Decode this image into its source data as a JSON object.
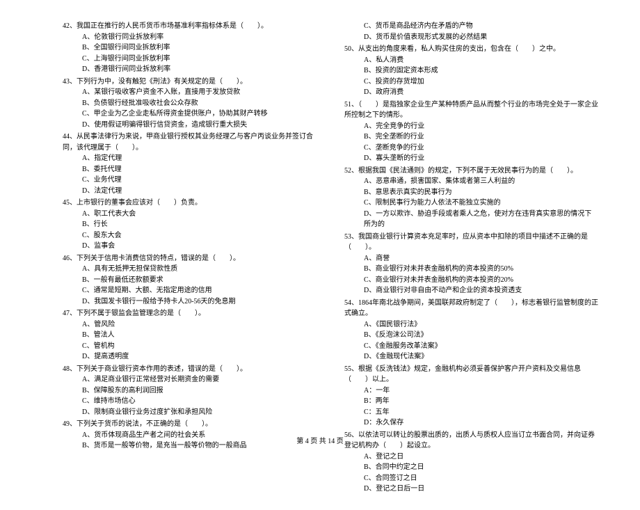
{
  "left": {
    "q42": {
      "text": "42、我国正在推行的人民币货币市场基准利率指标体系是（　　）。",
      "a": "A、伦敦银行同业拆放利率",
      "b": "B、全国银行间同业拆放利率",
      "c": "C、上海银行间同业拆放利率",
      "d": "D、香港银行间同业拆放利率"
    },
    "q43": {
      "text": "43、下列行为中，没有触犯《刑法》有关规定的是（　　）。",
      "a": "A、某银行吸收客户资金不入账，直接用于发放贷款",
      "b": "B、负债银行经批准吸收社会公众存款",
      "c": "C、甲企业为乙企业走私所得资金提供账户，协助其财产转移",
      "d": "D、使用假证明骗得银行信贷资金，造成银行重大损失"
    },
    "q44": {
      "text": "44、从民事法律行为来说，甲商业银行授权其业务经理乙与客户丙谈业务并签订合同，该代理属于（　　）。",
      "a": "A、指定代理",
      "b": "B、委托代理",
      "c": "C、业务代理",
      "d": "D、法定代理"
    },
    "q45": {
      "text": "45、上市银行的董事会应该对（　　）负责。",
      "a": "A、职工代表大会",
      "b": "B、行长",
      "c": "C、股东大会",
      "d": "D、监事会"
    },
    "q46": {
      "text": "46、下列关于信用卡消费信贷的特点，错误的是（　　）。",
      "a": "A、具有无抵押无担保贷款性质",
      "b": "B、一般有最低还款额要求",
      "c": "C、通常是短期、大额、无指定用途的信用",
      "d": "D、我国发卡银行一般给予持卡人20-56天的免息期"
    },
    "q47": {
      "text": "47、下列不属于银监会监管理念的是（　　）。",
      "a": "A、管风险",
      "b": "B、管法人",
      "c": "C、管机构",
      "d": "D、提高透明度"
    },
    "q48": {
      "text": "48、下列关于商业银行资本作用的表述，错误的是（　　）。",
      "a": "A、满足商业银行正常经营对长期资金的需要",
      "b": "B、保障股东的高利润回报",
      "c": "C、维持市场信心",
      "d": "D、限制商业银行业务过度扩张和承担风险"
    },
    "q49": {
      "text": "49、下列关于货币的说法，不正确的是（　　）。",
      "a": "A、货币体现商品生产者之间的社会关系",
      "b": "B、货币是一般等价物，是充当一般等价物的一般商品"
    }
  },
  "right": {
    "q49c": "C、货币是商品经济内在矛盾的产物",
    "q49d": "D、货币是价值表现形式发展的必然结果",
    "q50": {
      "text": "50、从支出的角度来看，私人购买住房的支出，包含在（　　）之中。",
      "a": "A、私人消费",
      "b": "B、投资的固定资本形成",
      "c": "C、投资的存货增加",
      "d": "D、政府消费"
    },
    "q51": {
      "text": "51、（　　）是指独家企业生产某种特质产品从而整个行业的市场完全处于一家企业所控制之下的情形。",
      "a": "A、完全竞争的行业",
      "b": "B、完全垄断的行业",
      "c": "C、垄断竞争的行业",
      "d": "D、寡头垄断的行业"
    },
    "q52": {
      "text": "52、根据我国《民法通则》的规定，下列不属于无效民事行为的是（　　）。",
      "a": "A、恶意串通，损害国家、集体或者第三人利益的",
      "b": "B、意思表示真实的民事行为",
      "c": "C、限制民事行为能力人依法不能独立实施的",
      "d": "D、一方以欺诈、胁迫手段或者乘人之危，使对方在违背真实意思的情况下所为的"
    },
    "q53": {
      "text": "53、我国商业银行计算资本充足率时，应从资本中扣除的项目中描述不正确的是（　　）。",
      "a": "A、商誉",
      "b": "B、商业银行对未并表金融机构的资本投资的50%",
      "c": "C、商业银行对未并表金融机构的资本投资的20%",
      "d": "D、商业银行对非自由不动产和企业的资本投资透支"
    },
    "q54": {
      "text": "54、1864年南北战争期间，美国联邦政府制定了（　　），标志着银行监管制度的正式确立。",
      "a": "A、《国民银行法》",
      "b": "B、《反泡沫公司法》",
      "c": "C、《金融服务改革法案》",
      "d": "D、《金融现代法案》"
    },
    "q55": {
      "text": "55、根据《反洗钱法》规定，金融机构必须妥善保护客户开户资料及交易信息（　　）以上。",
      "a": "A：一年",
      "b": "B：两年",
      "c": "C：五年",
      "d": "D：永久保存"
    },
    "q56": {
      "text": "56、以依法可以转让的股票出质的，出质人与质权人应当订立书面合同，并向证券登记机构办（　　）起设立。",
      "a": "A、登记之日",
      "b": "B、合同中约定之日",
      "c": "C、合同签订之日",
      "d": "D、登记之日后一日"
    }
  },
  "footer": "第 4 页 共 14 页"
}
